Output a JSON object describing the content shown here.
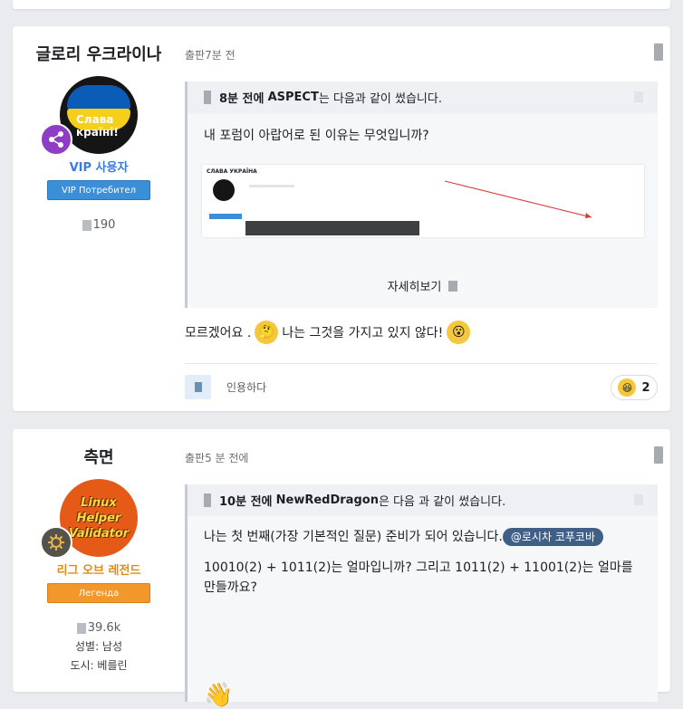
{
  "posts": [
    {
      "author": "글로리 우크라이나",
      "avatar_text": "Слава\nкраїні!",
      "rank": "VIP 사용자",
      "rank_badge": "VIP Потребител",
      "rank_color": "#3a7be2",
      "stat": "190",
      "time": "출판7분 전",
      "quote_time": "8분 전에",
      "quote_author": "ASPECT",
      "quote_suffix": "는 다음과 같이 썼습니다.",
      "quote_text": "내 포럼이 아랍어로 된 이유는 무엇입니까?",
      "screenshot_title": "СЛАВА УКРАЇНА",
      "read_more": "자세히보기",
      "message_a": "모르겠어요 .",
      "message_b": "나는 그것을 가지고 있지 않다!",
      "quote_button": "인용하다",
      "reaction_count": "2"
    },
    {
      "author": "측면",
      "avatar_text": "Linux\nHelper\nValidator",
      "rank": "리그 오브 레전드",
      "rank_badge": "Легенда",
      "rank_color": "#e38a12",
      "stat": "39.6k",
      "gender": "성별: 남성",
      "city": "도시: 베를린",
      "time": "출판5 분 전에",
      "quote_time": "10분 전에",
      "quote_author": "NewRedDragon",
      "quote_suffix": "은 다음 과 같이 썼습니다.",
      "quote_text_a": "나는 첫 번째(가장 기본적인 질문) 준비가 되어 있습니다.",
      "mention": "@로시차 코푸코바",
      "quote_text_b": "10010(2) + 1011(2)는 얼마입니까? 그리고 1011(2) + 11001(2)는 얼마를 만들까요?"
    }
  ]
}
